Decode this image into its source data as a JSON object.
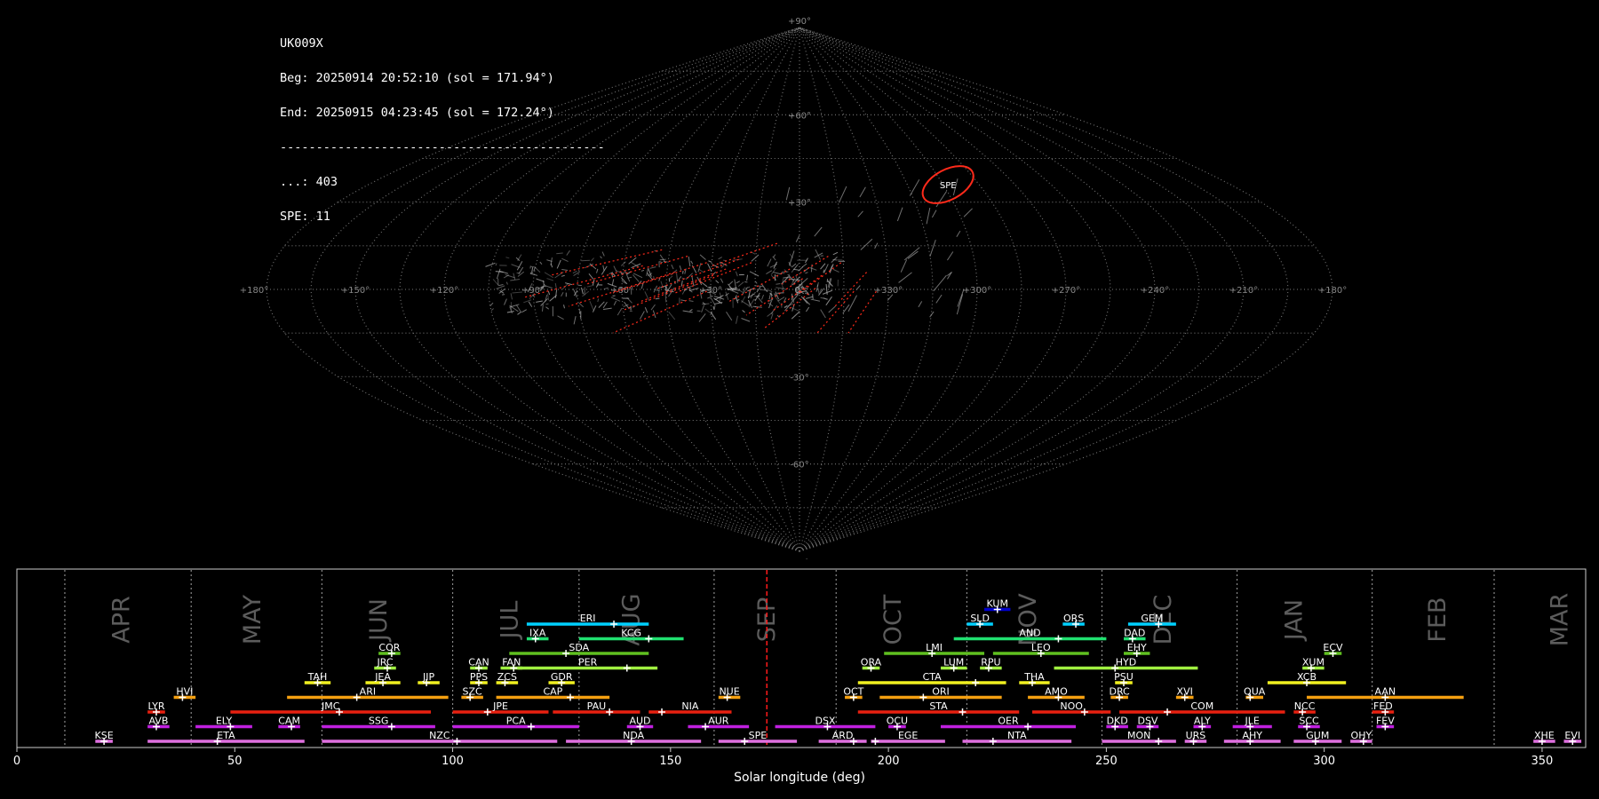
{
  "header": {
    "station": "UK009X",
    "begin": "Beg: 20250914 20:52:10 (sol = 171.94°)",
    "end": "End: 20250915 04:23:45 (sol = 172.24°)",
    "separator": "---------------------------------------------",
    "sporadic_count": "...: 403",
    "spe_count": "SPE: 11"
  },
  "chart_data": [
    {
      "type": "scatter",
      "projection": "sinusoidal sky map",
      "lat_ticks": [
        "+90°",
        "+60°",
        "+30°",
        "0°",
        "-30°",
        "-60°",
        "-90°"
      ],
      "lon_ticks": [
        "+180°",
        "+150°",
        "+120°",
        "+90°",
        "+60°",
        "+30°",
        "0°",
        "+330°",
        "+300°",
        "+270°",
        "+240°",
        "+210°",
        "+180°"
      ],
      "highlight": {
        "label": "SPE",
        "lon": 62,
        "lat": 36,
        "color": "#ff2a1a"
      },
      "grid": true
    },
    {
      "type": "timeline",
      "xlabel": "Solar longitude (deg)",
      "xlim": [
        0,
        360
      ],
      "xticks": [
        0,
        50,
        100,
        150,
        200,
        250,
        300,
        350
      ],
      "current_sol": 172.1,
      "month_boundaries": [
        11,
        40,
        70,
        100,
        129,
        160,
        188,
        218,
        249,
        280,
        311,
        339
      ],
      "months": [
        {
          "name": "APR",
          "sol": 24
        },
        {
          "name": "MAY",
          "sol": 54
        },
        {
          "name": "JUN",
          "sol": 83
        },
        {
          "name": "JUL",
          "sol": 113
        },
        {
          "name": "AUG",
          "sol": 141
        },
        {
          "name": "SEP",
          "sol": 172
        },
        {
          "name": "OCT",
          "sol": 201
        },
        {
          "name": "NOV",
          "sol": 232
        },
        {
          "name": "DEC",
          "sol": 263
        },
        {
          "name": "JAN",
          "sol": 293
        },
        {
          "name": "FEB",
          "sol": 326
        },
        {
          "name": "MAR",
          "sol": 354
        }
      ],
      "showers": [
        {
          "code": "KUM",
          "start": 222,
          "end": 228,
          "peak": 225,
          "row": 9,
          "color": "#0000cc"
        },
        {
          "code": "ERI",
          "start": 117,
          "end": 145,
          "peak": 137,
          "row": 8,
          "color": "#00d0ff"
        },
        {
          "code": "SLD",
          "start": 218,
          "end": 224,
          "peak": 221,
          "row": 8,
          "color": "#00d0ff"
        },
        {
          "code": "ORS",
          "start": 240,
          "end": 245,
          "peak": 243,
          "row": 8,
          "color": "#00d0ff"
        },
        {
          "code": "GEM",
          "start": 255,
          "end": 266,
          "peak": 262,
          "row": 8,
          "color": "#00d0ff"
        },
        {
          "code": "IXA",
          "start": 117,
          "end": 122,
          "peak": 119,
          "row": 7,
          "color": "#20e070"
        },
        {
          "code": "KCG",
          "start": 129,
          "end": 153,
          "peak": 145,
          "row": 7,
          "color": "#20e070"
        },
        {
          "code": "AND",
          "start": 215,
          "end": 250,
          "peak": 239,
          "row": 7,
          "color": "#20e070"
        },
        {
          "code": "DAD",
          "start": 254,
          "end": 259,
          "peak": 256,
          "row": 7,
          "color": "#20e070"
        },
        {
          "code": "COR",
          "start": 83,
          "end": 88,
          "peak": 86,
          "row": 6,
          "color": "#60c020"
        },
        {
          "code": "SDA",
          "start": 113,
          "end": 145,
          "peak": 126,
          "row": 6,
          "color": "#60c020"
        },
        {
          "code": "LMI",
          "start": 199,
          "end": 222,
          "peak": 210,
          "row": 6,
          "color": "#60c020"
        },
        {
          "code": "LEO",
          "start": 224,
          "end": 246,
          "peak": 235,
          "row": 6,
          "color": "#60c020"
        },
        {
          "code": "EHY",
          "start": 254,
          "end": 260,
          "peak": 257,
          "row": 6,
          "color": "#60c020"
        },
        {
          "code": "ECV",
          "start": 300,
          "end": 304,
          "peak": 302,
          "row": 6,
          "color": "#60c020"
        },
        {
          "code": "JRC",
          "start": 82,
          "end": 87,
          "peak": 85,
          "row": 5,
          "color": "#a0f040"
        },
        {
          "code": "CAN",
          "start": 104,
          "end": 108,
          "peak": 106,
          "row": 5,
          "color": "#a0f040"
        },
        {
          "code": "FAN",
          "start": 111,
          "end": 116,
          "peak": 114,
          "row": 5,
          "color": "#a0f040"
        },
        {
          "code": "PER",
          "start": 115,
          "end": 147,
          "peak": 140,
          "row": 5,
          "color": "#a0f040"
        },
        {
          "code": "ORA",
          "start": 194,
          "end": 198,
          "peak": 196,
          "row": 5,
          "color": "#a0f040"
        },
        {
          "code": "LUM",
          "start": 212,
          "end": 218,
          "peak": 215,
          "row": 5,
          "color": "#a0f040"
        },
        {
          "code": "RPU",
          "start": 221,
          "end": 226,
          "peak": 223,
          "row": 5,
          "color": "#a0f040"
        },
        {
          "code": "HYD",
          "start": 238,
          "end": 271,
          "peak": 252,
          "row": 5,
          "color": "#a0f040"
        },
        {
          "code": "XUM",
          "start": 295,
          "end": 300,
          "peak": 297,
          "row": 5,
          "color": "#a0f040"
        },
        {
          "code": "TAH",
          "start": 66,
          "end": 72,
          "peak": 69,
          "row": 4,
          "color": "#f0f020"
        },
        {
          "code": "JEA",
          "start": 80,
          "end": 88,
          "peak": 84,
          "row": 4,
          "color": "#f0f020"
        },
        {
          "code": "JIP",
          "start": 92,
          "end": 97,
          "peak": 94,
          "row": 4,
          "color": "#f0f020"
        },
        {
          "code": "PPS",
          "start": 104,
          "end": 108,
          "peak": 106,
          "row": 4,
          "color": "#f0f020"
        },
        {
          "code": "ZCS",
          "start": 110,
          "end": 115,
          "peak": 112,
          "row": 4,
          "color": "#f0f020"
        },
        {
          "code": "GDR",
          "start": 122,
          "end": 128,
          "peak": 125,
          "row": 4,
          "color": "#f0f020"
        },
        {
          "code": "CTA",
          "start": 193,
          "end": 227,
          "peak": 220,
          "row": 4,
          "color": "#f0f020"
        },
        {
          "code": "THA",
          "start": 230,
          "end": 237,
          "peak": 233,
          "row": 4,
          "color": "#f0f020"
        },
        {
          "code": "PSU",
          "start": 252,
          "end": 256,
          "peak": 254,
          "row": 4,
          "color": "#f0f020"
        },
        {
          "code": "XCB",
          "start": 287,
          "end": 305,
          "peak": 296,
          "row": 4,
          "color": "#f0f020"
        },
        {
          "code": "HVI",
          "start": 36,
          "end": 41,
          "peak": 38,
          "row": 3,
          "color": "#f5a010"
        },
        {
          "code": "ARI",
          "start": 62,
          "end": 99,
          "peak": 78,
          "row": 3,
          "color": "#f5a010"
        },
        {
          "code": "SZC",
          "start": 102,
          "end": 107,
          "peak": 104,
          "row": 3,
          "color": "#f5a010"
        },
        {
          "code": "CAP",
          "start": 110,
          "end": 136,
          "peak": 127,
          "row": 3,
          "color": "#f5a010"
        },
        {
          "code": "NUE",
          "start": 161,
          "end": 166,
          "peak": 163,
          "row": 3,
          "color": "#f5a010"
        },
        {
          "code": "OCT",
          "start": 190,
          "end": 194,
          "peak": 192,
          "row": 3,
          "color": "#f5a010"
        },
        {
          "code": "ORI",
          "start": 198,
          "end": 226,
          "peak": 208,
          "row": 3,
          "color": "#f5a010"
        },
        {
          "code": "AMO",
          "start": 232,
          "end": 245,
          "peak": 239,
          "row": 3,
          "color": "#f5a010"
        },
        {
          "code": "DRC",
          "start": 251,
          "end": 255,
          "peak": 253,
          "row": 3,
          "color": "#f5a010"
        },
        {
          "code": "XVI",
          "start": 266,
          "end": 270,
          "peak": 268,
          "row": 3,
          "color": "#f5a010"
        },
        {
          "code": "QUA",
          "start": 282,
          "end": 286,
          "peak": 283,
          "row": 3,
          "color": "#f5a010"
        },
        {
          "code": "AAN",
          "start": 296,
          "end": 332,
          "peak": 314,
          "row": 3,
          "color": "#f5a010"
        },
        {
          "code": "LYR",
          "start": 30,
          "end": 34,
          "peak": 32,
          "row": 2,
          "color": "#e82010"
        },
        {
          "code": "JMC",
          "start": 49,
          "end": 95,
          "peak": 74,
          "row": 2,
          "color": "#e82010"
        },
        {
          "code": "JPE",
          "start": 100,
          "end": 122,
          "peak": 108,
          "row": 2,
          "color": "#e82010"
        },
        {
          "code": "PAU",
          "start": 123,
          "end": 143,
          "peak": 136,
          "row": 2,
          "color": "#e82010"
        },
        {
          "code": "NIA",
          "start": 145,
          "end": 164,
          "peak": 148,
          "row": 2,
          "color": "#e82010"
        },
        {
          "code": "STA",
          "start": 193,
          "end": 230,
          "peak": 217,
          "row": 2,
          "color": "#e82010"
        },
        {
          "code": "NOO",
          "start": 233,
          "end": 251,
          "peak": 245,
          "row": 2,
          "color": "#e82010"
        },
        {
          "code": "COM",
          "start": 253,
          "end": 291,
          "peak": 264,
          "row": 2,
          "color": "#e82010"
        },
        {
          "code": "NCC",
          "start": 293,
          "end": 298,
          "peak": 295,
          "row": 2,
          "color": "#e82010"
        },
        {
          "code": "FED",
          "start": 311,
          "end": 316,
          "peak": 314,
          "row": 2,
          "color": "#e82010"
        },
        {
          "code": "AVB",
          "start": 30,
          "end": 35,
          "peak": 32,
          "row": 1,
          "color": "#c020e0"
        },
        {
          "code": "ELY",
          "start": 41,
          "end": 54,
          "peak": 49,
          "row": 1,
          "color": "#c020e0"
        },
        {
          "code": "CAM",
          "start": 60,
          "end": 65,
          "peak": 63,
          "row": 1,
          "color": "#c020e0"
        },
        {
          "code": "SSG",
          "start": 70,
          "end": 96,
          "peak": 86,
          "row": 1,
          "color": "#c020e0"
        },
        {
          "code": "PCA",
          "start": 100,
          "end": 129,
          "peak": 118,
          "row": 1,
          "color": "#c020e0"
        },
        {
          "code": "AUD",
          "start": 140,
          "end": 146,
          "peak": 143,
          "row": 1,
          "color": "#c020e0"
        },
        {
          "code": "AUR",
          "start": 154,
          "end": 168,
          "peak": 158,
          "row": 1,
          "color": "#c020e0"
        },
        {
          "code": "DSX",
          "start": 174,
          "end": 197,
          "peak": 186,
          "row": 1,
          "color": "#c020e0"
        },
        {
          "code": "OCU",
          "start": 200,
          "end": 204,
          "peak": 202,
          "row": 1,
          "color": "#c020e0"
        },
        {
          "code": "OER",
          "start": 212,
          "end": 243,
          "peak": 232,
          "row": 1,
          "color": "#c020e0"
        },
        {
          "code": "DKD",
          "start": 250,
          "end": 255,
          "peak": 252,
          "row": 1,
          "color": "#c020e0"
        },
        {
          "code": "DSV",
          "start": 257,
          "end": 262,
          "peak": 260,
          "row": 1,
          "color": "#c020e0"
        },
        {
          "code": "ALY",
          "start": 270,
          "end": 274,
          "peak": 272,
          "row": 1,
          "color": "#c020e0"
        },
        {
          "code": "JLE",
          "start": 279,
          "end": 288,
          "peak": 283,
          "row": 1,
          "color": "#c020e0"
        },
        {
          "code": "SCC",
          "start": 294,
          "end": 299,
          "peak": 296,
          "row": 1,
          "color": "#c020e0"
        },
        {
          "code": "FEV",
          "start": 312,
          "end": 316,
          "peak": 314,
          "row": 1,
          "color": "#c020e0"
        },
        {
          "code": "KSE",
          "start": 18,
          "end": 22,
          "peak": 20,
          "row": 0,
          "color": "#e070e0"
        },
        {
          "code": "ETA",
          "start": 30,
          "end": 66,
          "peak": 46,
          "row": 0,
          "color": "#e070e0"
        },
        {
          "code": "NZC",
          "start": 70,
          "end": 124,
          "peak": 101,
          "row": 0,
          "color": "#e070e0"
        },
        {
          "code": "NDA",
          "start": 126,
          "end": 157,
          "peak": 141,
          "row": 0,
          "color": "#e070e0"
        },
        {
          "code": "SPE",
          "start": 161,
          "end": 179,
          "peak": 167,
          "row": 0,
          "color": "#e070e0"
        },
        {
          "code": "ARD",
          "start": 184,
          "end": 195,
          "peak": 192,
          "row": 0,
          "color": "#e070e0"
        },
        {
          "code": "EGE",
          "start": 196,
          "end": 213,
          "peak": 197,
          "row": 0,
          "color": "#e070e0"
        },
        {
          "code": "NTA",
          "start": 217,
          "end": 242,
          "peak": 224,
          "row": 0,
          "color": "#e070e0"
        },
        {
          "code": "MON",
          "start": 249,
          "end": 266,
          "peak": 262,
          "row": 0,
          "color": "#e070e0"
        },
        {
          "code": "URS",
          "start": 268,
          "end": 273,
          "peak": 270,
          "row": 0,
          "color": "#e070e0"
        },
        {
          "code": "AHY",
          "start": 277,
          "end": 290,
          "peak": 283,
          "row": 0,
          "color": "#e070e0"
        },
        {
          "code": "GUM",
          "start": 293,
          "end": 304,
          "peak": 298,
          "row": 0,
          "color": "#e070e0"
        },
        {
          "code": "OHY",
          "start": 306,
          "end": 311,
          "peak": 309,
          "row": 0,
          "color": "#e070e0"
        },
        {
          "code": "XHE",
          "start": 348,
          "end": 353,
          "peak": 350,
          "row": 0,
          "color": "#e070e0"
        },
        {
          "code": "EVI",
          "start": 355,
          "end": 359,
          "peak": 357,
          "row": 0,
          "color": "#e070e0"
        }
      ]
    }
  ]
}
